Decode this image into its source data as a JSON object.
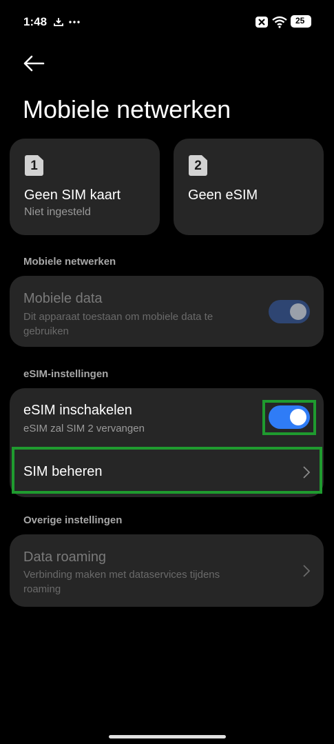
{
  "status_bar": {
    "time": "1:48",
    "battery": "25"
  },
  "page_title": "Mobiele netwerken",
  "sim_cards": [
    {
      "badge": "1",
      "title": "Geen SIM kaart",
      "subtitle": "Niet ingesteld"
    },
    {
      "badge": "2",
      "title": "Geen eSIM"
    }
  ],
  "sections": {
    "mobile": "Mobiele netwerken",
    "esim": "eSIM-instellingen",
    "other": "Overige instellingen"
  },
  "mobile_data": {
    "title": "Mobiele data",
    "subtitle": "Dit apparaat toestaan om mobiele data te gebruiken"
  },
  "esim_enable": {
    "title": "eSIM inschakelen",
    "subtitle": "eSIM zal SIM 2 vervangen"
  },
  "manage_sim": {
    "title": "SIM beheren"
  },
  "data_roaming": {
    "title": "Data roaming",
    "subtitle": "Verbinding maken met dataservices tijdens roaming"
  },
  "colors": {
    "accent": "#2f7cf6",
    "card": "#262626",
    "highlight": "#1f9b2f"
  }
}
